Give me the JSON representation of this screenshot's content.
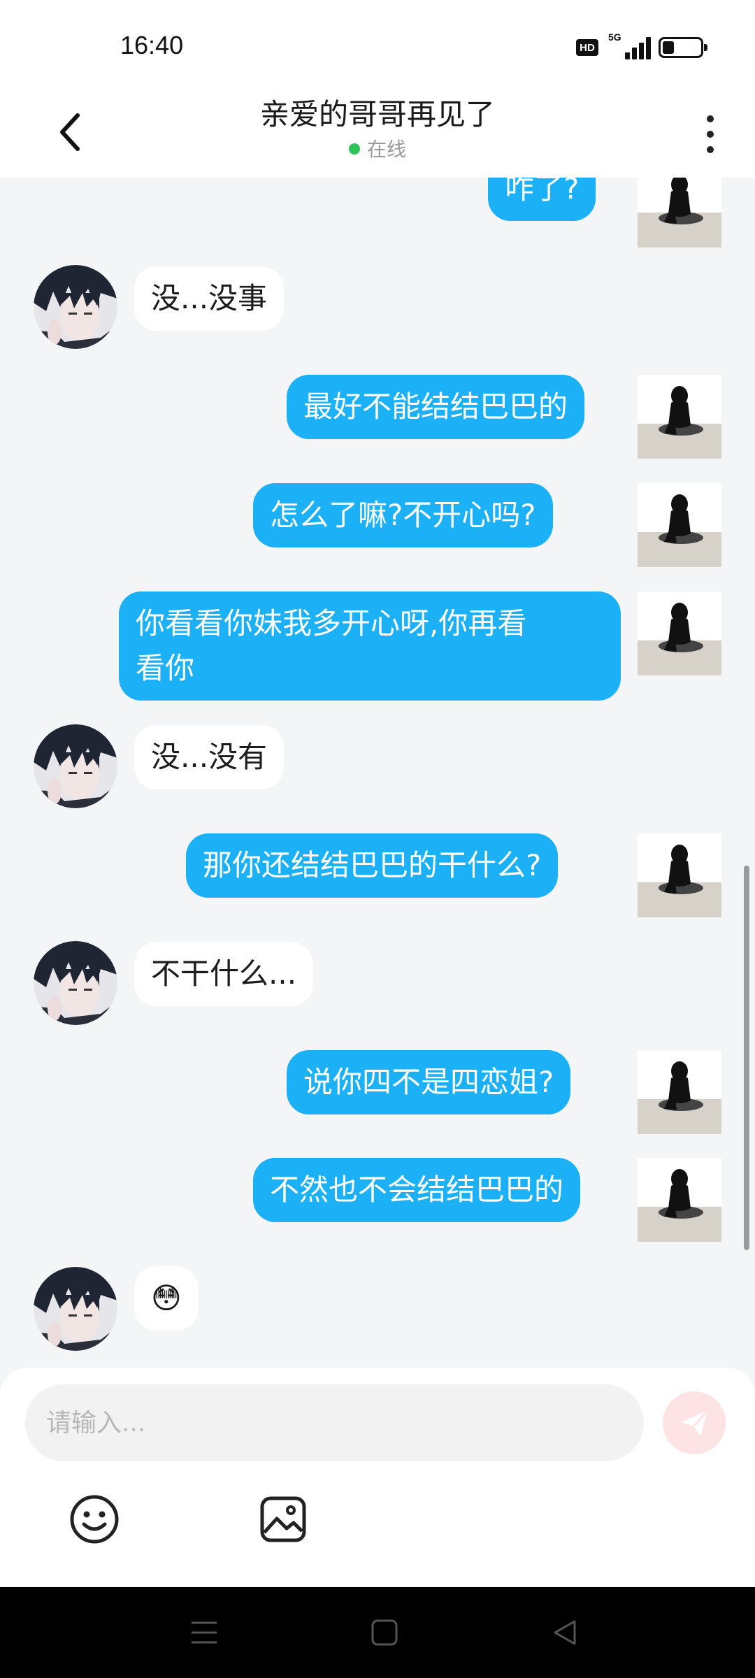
{
  "status_bar": {
    "time": "16:40",
    "hd": "HD",
    "network": "5G",
    "battery_level": 0.3
  },
  "header": {
    "title": "亲爱的哥哥再见了",
    "status": "在线"
  },
  "messages": [
    {
      "from": "me",
      "text": "咋了?"
    },
    {
      "from": "other",
      "text": "没...没事"
    },
    {
      "from": "me",
      "text": "最好不能结结巴巴的"
    },
    {
      "from": "me",
      "text": "怎么了嘛?不开心吗?"
    },
    {
      "from": "me",
      "text_line1": "你看看你妹我多开心呀,你再看",
      "text_line2": "看你"
    },
    {
      "from": "other",
      "text": "没...没有"
    },
    {
      "from": "me",
      "text": "那你还结结巴巴的干什么?"
    },
    {
      "from": "other",
      "text": "不干什么..."
    },
    {
      "from": "me",
      "text": "说你四不是四恋姐?"
    },
    {
      "from": "me",
      "text": "不然也不会结结巴巴的"
    },
    {
      "from": "other",
      "text": "😳"
    }
  ],
  "composer": {
    "placeholder": "请输入..."
  },
  "icons": {
    "back": "chevron-left-icon",
    "more": "more-vertical-icon",
    "send": "send-icon",
    "emoji": "smiley-icon",
    "image": "image-icon"
  },
  "colors": {
    "outgoing_bubble": "#1cb0f6",
    "incoming_bubble": "#ffffff",
    "background": "#f4f5f7",
    "online_dot": "#2fc25b"
  }
}
